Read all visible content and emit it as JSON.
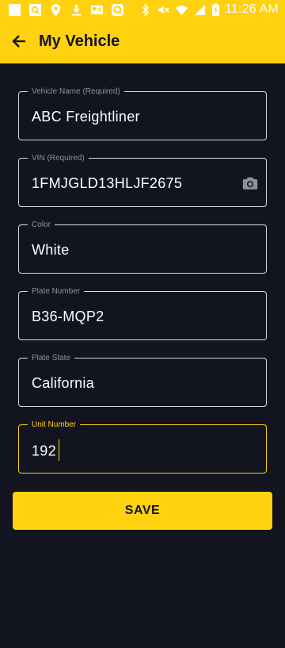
{
  "status_bar": {
    "time": "11:26 AM",
    "left_icons": [
      "notification-square-icon",
      "image-search-icon",
      "location-pin-icon",
      "download-icon",
      "cast-icon",
      "q-app-icon"
    ],
    "right_icons": [
      "bluetooth-icon",
      "mute-icon",
      "wifi-icon",
      "signal-icon",
      "battery-charging-icon"
    ]
  },
  "app_bar": {
    "title": "My Vehicle",
    "back_icon": "arrow-left-icon"
  },
  "form": {
    "fields": [
      {
        "label": "Vehicle Name (Required)",
        "value": "ABC Freightliner"
      },
      {
        "label": "VIN (Required)",
        "value": "1FMJGLD13HLJF2675",
        "action_icon": "camera-icon"
      },
      {
        "label": "Color",
        "value": "White"
      },
      {
        "label": "Plate Number",
        "value": "B36-MQP2"
      },
      {
        "label": "Plate State",
        "value": "California"
      },
      {
        "label": "Unit Number",
        "value": "192",
        "focused": true
      }
    ],
    "save_label": "SAVE"
  },
  "colors": {
    "accent": "#ffd10f",
    "background": "#12151f",
    "border": "#d9d9d9",
    "label": "#8f9199",
    "text": "#ffffff"
  }
}
